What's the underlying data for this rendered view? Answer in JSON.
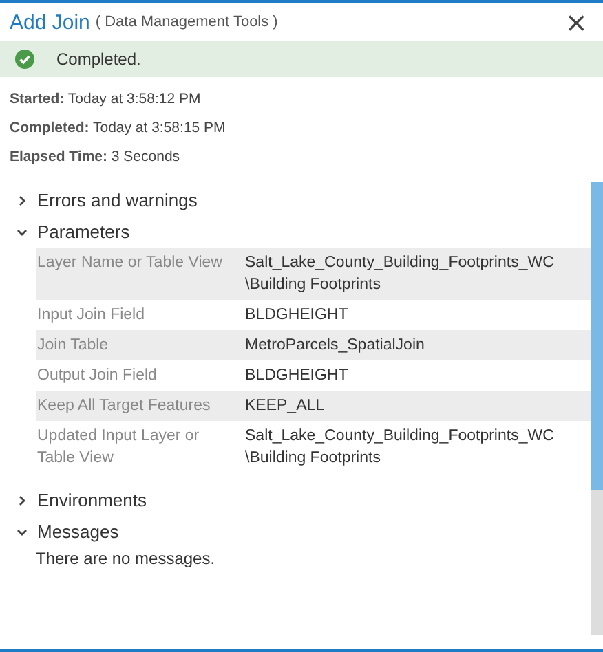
{
  "window": {
    "title": "Add Join",
    "subtitle": "( Data Management Tools )",
    "close": "×"
  },
  "status": {
    "kind": "success",
    "text": "Completed."
  },
  "details": [
    {
      "label": "Started:",
      "value": "Today at 3:58:12 PM"
    },
    {
      "label": "Completed:",
      "value": "Today at 3:58:15 PM"
    },
    {
      "label": "Elapsed Time:",
      "value": "3 Seconds"
    }
  ],
  "sections": [
    {
      "title": "Errors and warnings",
      "expanded": false
    },
    {
      "title": "Parameters",
      "expanded": true,
      "rows": [
        {
          "name": "Layer Name or Table View",
          "value": "Salt_Lake_County_Building_Footprints_WC \\Building Footprints"
        },
        {
          "name": "Input Join Field",
          "value": "BLDGHEIGHT"
        },
        {
          "name": "Join Table",
          "value": "MetroParcels_SpatialJoin"
        },
        {
          "name": "Output Join Field",
          "value": "BLDGHEIGHT"
        },
        {
          "name": "Keep All Target Features",
          "value": "KEEP_ALL"
        },
        {
          "name": "Updated Input Layer or Table View",
          "value": "Salt_Lake_County_Building_Footprints_WC \\Building Footprints"
        }
      ]
    },
    {
      "title": "Environments",
      "expanded": false
    },
    {
      "title": "Messages",
      "expanded": true,
      "text": "There are no messages."
    }
  ]
}
